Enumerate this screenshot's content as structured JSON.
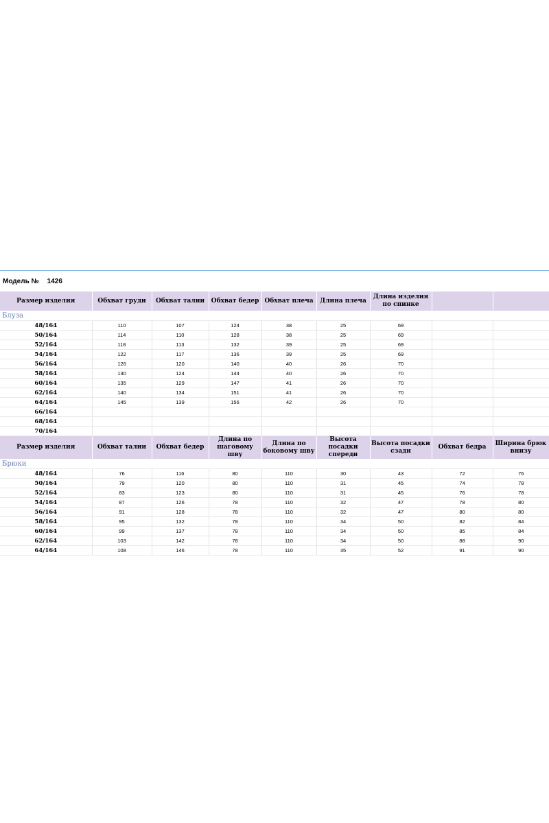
{
  "model_label": "Модель №",
  "model_number": "1426",
  "blouse": {
    "section_name": "Блуза",
    "headers": [
      "Размер изделия",
      "Обхват груди",
      "Обхват талии",
      "Обхват бедер",
      "Обхват плеча",
      "Длина плеча",
      "Длина изделия по спинке",
      "",
      ""
    ],
    "rows": [
      [
        "48/164",
        "110",
        "107",
        "124",
        "38",
        "25",
        "69",
        "",
        ""
      ],
      [
        "50/164",
        "114",
        "110",
        "128",
        "38",
        "25",
        "69",
        "",
        ""
      ],
      [
        "52/164",
        "118",
        "113",
        "132",
        "39",
        "25",
        "69",
        "",
        ""
      ],
      [
        "54/164",
        "122",
        "117",
        "136",
        "39",
        "25",
        "69",
        "",
        ""
      ],
      [
        "56/164",
        "126",
        "120",
        "140",
        "40",
        "26",
        "70",
        "",
        ""
      ],
      [
        "58/164",
        "130",
        "124",
        "144",
        "40",
        "26",
        "70",
        "",
        ""
      ],
      [
        "60/164",
        "135",
        "129",
        "147",
        "41",
        "26",
        "70",
        "",
        ""
      ],
      [
        "62/164",
        "140",
        "134",
        "151",
        "41",
        "26",
        "70",
        "",
        ""
      ],
      [
        "64/164",
        "145",
        "139",
        "156",
        "42",
        "26",
        "70",
        "",
        ""
      ],
      [
        "66/164",
        "",
        "",
        "",
        "",
        "",
        "",
        "",
        ""
      ],
      [
        "68/164",
        "",
        "",
        "",
        "",
        "",
        "",
        "",
        ""
      ],
      [
        "70/164",
        "",
        "",
        "",
        "",
        "",
        "",
        "",
        ""
      ]
    ]
  },
  "trousers": {
    "section_name": "Брюки",
    "headers": [
      "Размер изделия",
      "Обхват талии",
      "Обхват бедер",
      "Длина по шаговому шву",
      "Длина по боковому шву",
      "Высота посадки спереди",
      "Высота посадки сзади",
      "Обхват бедра",
      "Ширина брюк внизу"
    ],
    "rows": [
      [
        "48/164",
        "76",
        "116",
        "80",
        "110",
        "30",
        "43",
        "72",
        "76"
      ],
      [
        "50/164",
        "79",
        "120",
        "80",
        "110",
        "31",
        "45",
        "74",
        "78"
      ],
      [
        "52/164",
        "83",
        "123",
        "80",
        "110",
        "31",
        "45",
        "76",
        "78"
      ],
      [
        "54/164",
        "87",
        "126",
        "78",
        "110",
        "32",
        "47",
        "78",
        "80"
      ],
      [
        "56/164",
        "91",
        "128",
        "78",
        "110",
        "32",
        "47",
        "80",
        "80"
      ],
      [
        "58/164",
        "95",
        "132",
        "78",
        "110",
        "34",
        "50",
        "82",
        "84"
      ],
      [
        "60/164",
        "99",
        "137",
        "78",
        "110",
        "34",
        "50",
        "85",
        "84"
      ],
      [
        "62/164",
        "103",
        "142",
        "78",
        "110",
        "34",
        "50",
        "88",
        "90"
      ],
      [
        "64/164",
        "108",
        "146",
        "78",
        "110",
        "35",
        "52",
        "91",
        "90"
      ]
    ]
  }
}
